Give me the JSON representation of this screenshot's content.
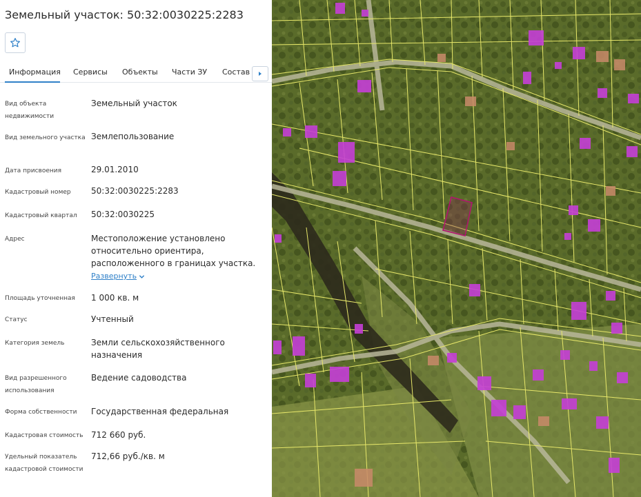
{
  "panel": {
    "title": "Земельный участок: 50:32:0030225:2283",
    "favorite_icon": "star-outline-icon",
    "tabs": [
      "Информация",
      "Сервисы",
      "Объекты",
      "Части ЗУ",
      "Состав Е"
    ],
    "tab_more_icon": "caret-right-icon",
    "fields": [
      {
        "label": "Вид объекта недвижимости",
        "value": "Земельный участок"
      },
      {
        "label": "Вид земельного участка",
        "value": "Землепользование"
      },
      {
        "label": "Дата присвоения",
        "value": "29.01.2010"
      },
      {
        "label": "Кадастровый номер",
        "value": "50:32:0030225:2283"
      },
      {
        "label": "Кадастровый квартал",
        "value": "50:32:0030225"
      },
      {
        "label": "Адрес",
        "value": "Местоположение установлено относительно ориентира, расположенного в границах участка."
      },
      {
        "label": "Площадь уточненная",
        "value": "1 000 кв. м"
      },
      {
        "label": "Статус",
        "value": "Учтенный"
      },
      {
        "label": "Категория земель",
        "value": "Земли сельскохозяйственного назначения"
      },
      {
        "label": "Вид разрешенного использования",
        "value": "Ведение садоводства"
      },
      {
        "label": "Форма собственности",
        "value": "Государственная федеральная"
      },
      {
        "label": "Кадастровая стоимость",
        "value": "712 660 руб."
      },
      {
        "label": "Удельный показатель кадастровой стоимости",
        "value": "712,66 руб./кв. м"
      }
    ],
    "expand_link": "Развернуть",
    "expand_icon": "chevron-down-icon"
  },
  "colors": {
    "accent": "#2f80c8",
    "parcel_line": "#e8e86a",
    "selected_parcel": "#b0156e",
    "building": "#c53fd6",
    "map_ground": "#5f6e2c"
  }
}
